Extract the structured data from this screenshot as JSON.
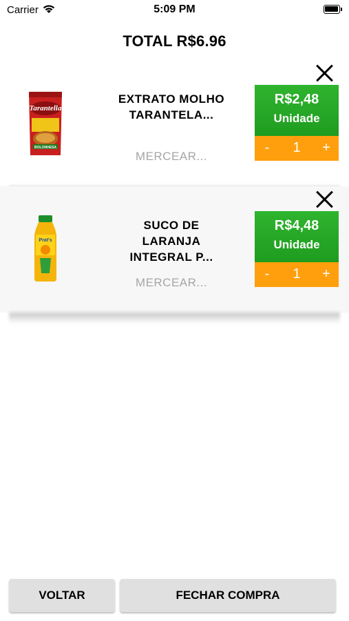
{
  "status_bar": {
    "carrier": "Carrier",
    "time": "5:09 PM"
  },
  "header": {
    "total": "TOTAL R$6.96"
  },
  "cart": {
    "items": [
      {
        "name": "EXTRATO MOLHO TARANTELA...",
        "category": "MERCEAR...",
        "price": "R$2,48",
        "unit": "Unidade",
        "qty_minus": "-",
        "quantity": "1",
        "qty_plus": "+",
        "image_brand": "Tarantella",
        "image_subtext": "BOLONHESA"
      },
      {
        "name": "SUCO DE LARANJA INTEGRAL P...",
        "category": "MERCEAR...",
        "price": "R$4,48",
        "unit": "Unidade",
        "qty_minus": "-",
        "quantity": "1",
        "qty_plus": "+",
        "image_brand": "Prat's"
      }
    ]
  },
  "footer": {
    "back_label": "VOLTAR",
    "checkout_label": "FECHAR COMPRA"
  },
  "colors": {
    "price_green": "#25a825",
    "qty_orange": "#ff9f0d",
    "button_grey": "#e0e0e0"
  }
}
